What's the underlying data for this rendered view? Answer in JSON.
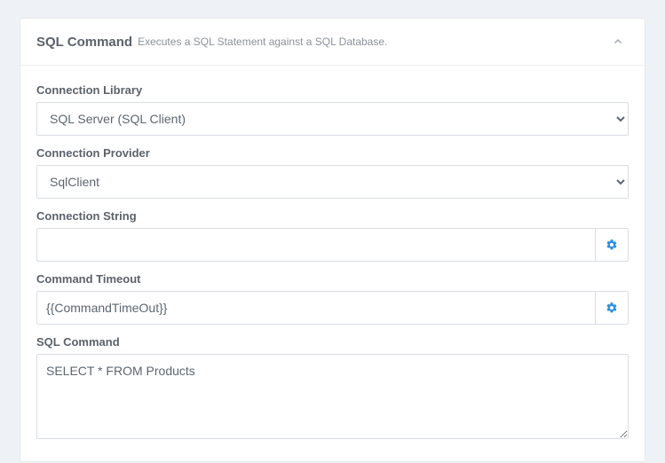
{
  "header": {
    "title": "SQL Command",
    "subtitle": "Executes a SQL Statement against a SQL Database."
  },
  "fields": {
    "connection_library": {
      "label": "Connection Library",
      "value": "SQL Server (SQL Client)"
    },
    "connection_provider": {
      "label": "Connection Provider",
      "value": "SqlClient"
    },
    "connection_string": {
      "label": "Connection String",
      "value": ""
    },
    "command_timeout": {
      "label": "Command Timeout",
      "value": "{{CommandTimeOut}}"
    },
    "sql_command": {
      "label": "SQL Command",
      "value": "SELECT * FROM Products"
    }
  }
}
